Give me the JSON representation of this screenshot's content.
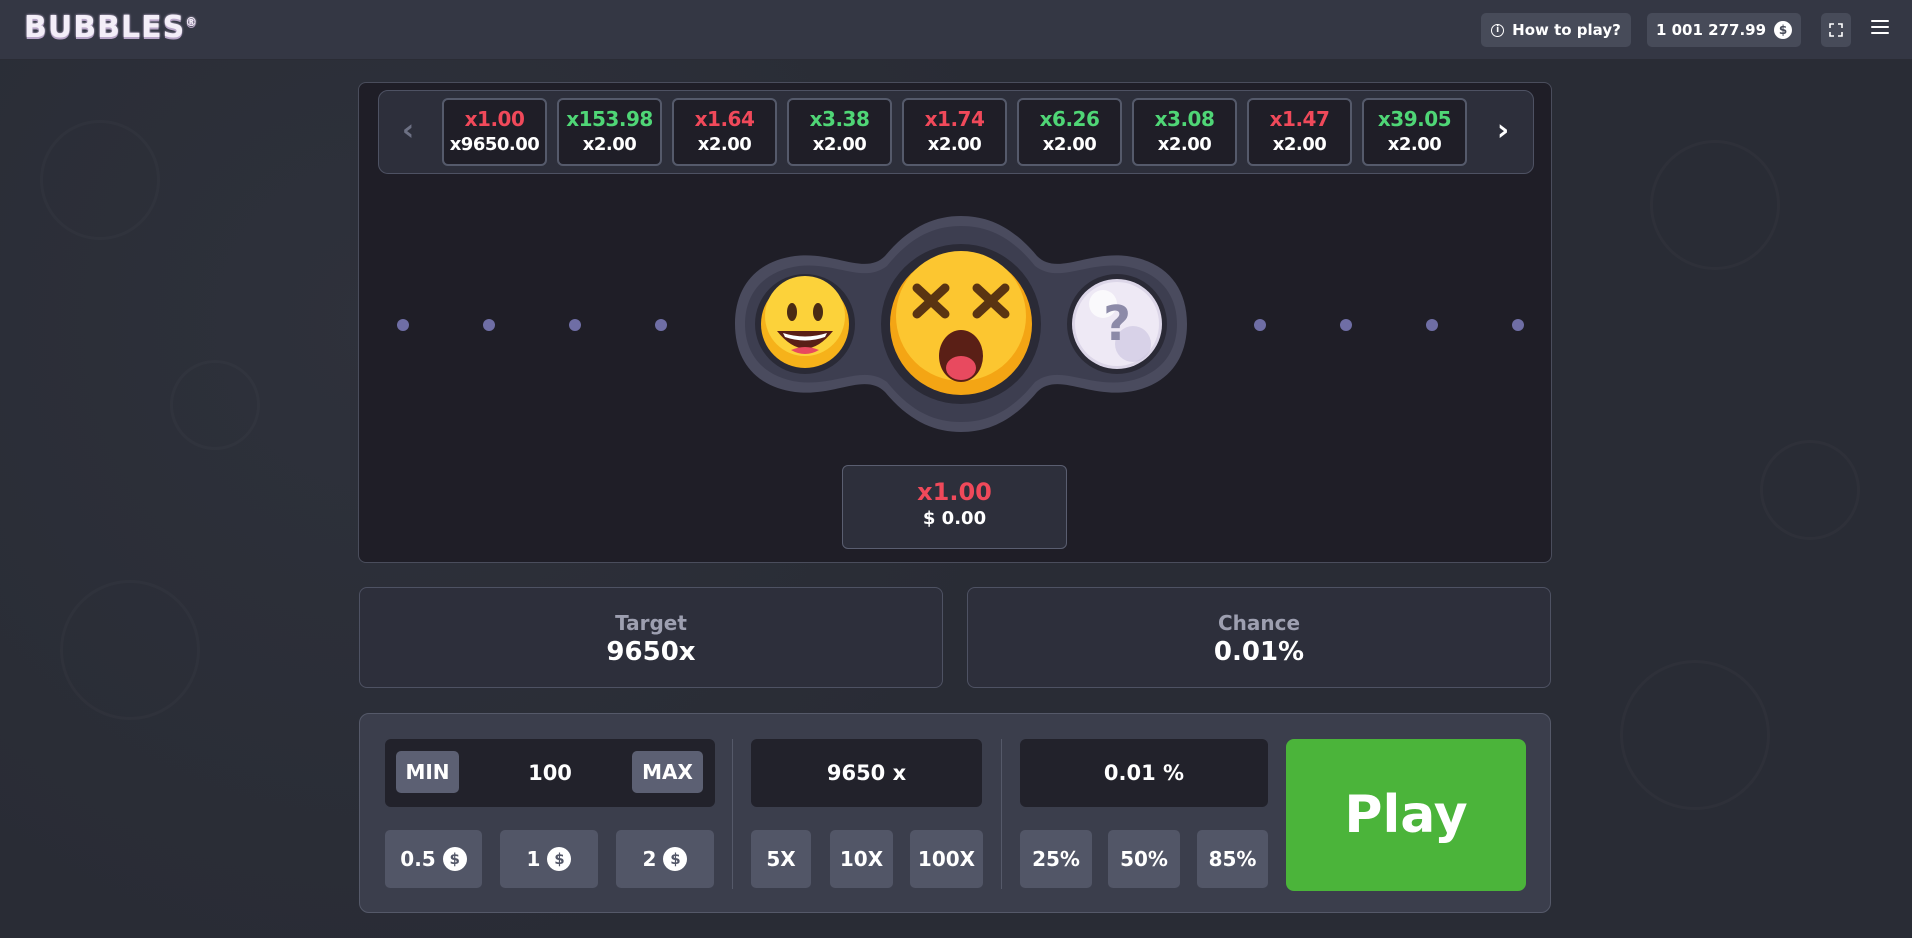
{
  "header": {
    "logo": "BUBBLES",
    "how_to_play": "How to play?",
    "info_glyph": "i",
    "balance": "1 001 277.99",
    "currency_symbol": "$"
  },
  "history": {
    "items": [
      {
        "multiplier": "x1.00",
        "target": "x9650.00",
        "result": "loss"
      },
      {
        "multiplier": "x153.98",
        "target": "x2.00",
        "result": "win"
      },
      {
        "multiplier": "x1.64",
        "target": "x2.00",
        "result": "loss"
      },
      {
        "multiplier": "x3.38",
        "target": "x2.00",
        "result": "win"
      },
      {
        "multiplier": "x1.74",
        "target": "x2.00",
        "result": "loss"
      },
      {
        "multiplier": "x6.26",
        "target": "x2.00",
        "result": "win"
      },
      {
        "multiplier": "x3.08",
        "target": "x2.00",
        "result": "win"
      },
      {
        "multiplier": "x1.47",
        "target": "x2.00",
        "result": "loss"
      },
      {
        "multiplier": "x39.05",
        "target": "x2.00",
        "result": "win"
      }
    ],
    "prev_icon": "chevron-left-icon",
    "next_icon": "chevron-right-icon"
  },
  "bubbles": {
    "left": "grinning-face-icon",
    "center": "dizzy-face-icon",
    "right": "question-bubble-icon"
  },
  "result": {
    "multiplier": "x1.00",
    "payout": "$ 0.00"
  },
  "target": {
    "label": "Target",
    "value": "9650x"
  },
  "chance": {
    "label": "Chance",
    "value": "0.01%"
  },
  "controls": {
    "min_label": "MIN",
    "max_label": "MAX",
    "bet_value": "100",
    "target_input": "9650 x",
    "chance_input": "0.01 %",
    "bet_presets": [
      "0.5",
      "1",
      "2"
    ],
    "target_presets": [
      "5X",
      "10X",
      "100X"
    ],
    "chance_presets": [
      "25%",
      "50%",
      "85%"
    ],
    "play_label": "Play"
  },
  "colors": {
    "win": "#4fd676",
    "loss": "#f0495a",
    "play": "#4bb43a",
    "accent_dot": "#6f6ea5"
  }
}
